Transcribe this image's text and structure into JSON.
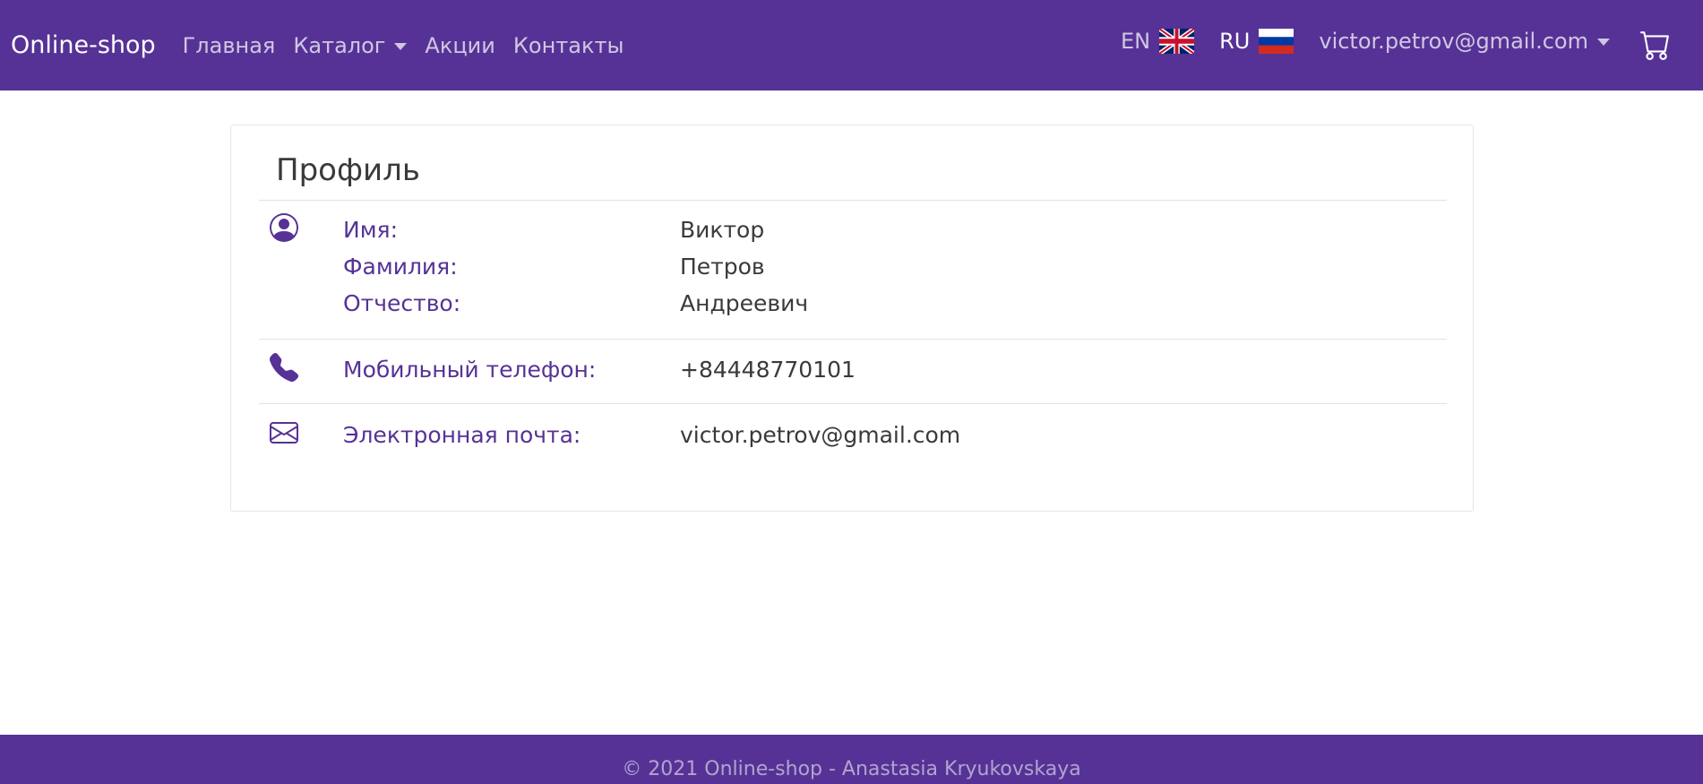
{
  "navbar": {
    "brand": "Online-shop",
    "links": [
      {
        "label": "Главная"
      },
      {
        "label": "Каталог",
        "dropdown": true
      },
      {
        "label": "Акции"
      },
      {
        "label": "Контакты"
      }
    ],
    "languages": [
      {
        "code": "EN",
        "flag": "uk-flag-icon"
      },
      {
        "code": "RU",
        "flag": "russia-flag-icon"
      }
    ],
    "user_email": "victor.petrov@gmail.com",
    "cart_icon": "cart-icon"
  },
  "profile": {
    "title": "Профиль",
    "name_section": {
      "icon": "user-circle-icon",
      "first_name_label": "Имя:",
      "first_name": "Виктор",
      "last_name_label": "Фамилия:",
      "last_name": "Петров",
      "patronymic_label": "Отчество:",
      "patronymic": "Андреевич"
    },
    "phone_section": {
      "icon": "phone-icon",
      "label": "Мобильный телефон:",
      "value": "+84448770101"
    },
    "email_section": {
      "icon": "envelope-icon",
      "label": "Электронная почта:",
      "value": "victor.petrov@gmail.com"
    }
  },
  "footer": {
    "text": "© 2021 Online-shop - Anastasia Kryukovskaya"
  },
  "colors": {
    "brand": "#563296",
    "accent_text": "#563296",
    "body_text": "#3a3a3a"
  }
}
